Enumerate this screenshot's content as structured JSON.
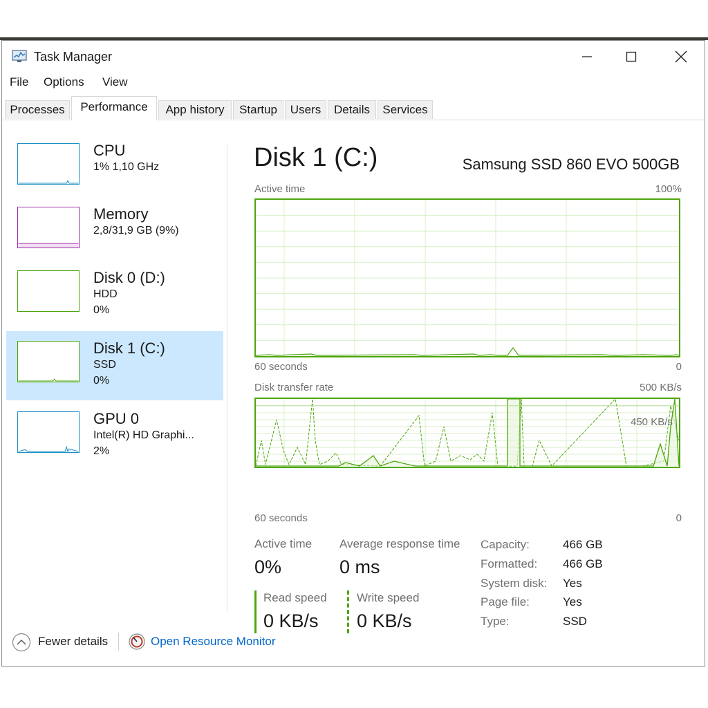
{
  "window": {
    "title": "Task Manager"
  },
  "menu": [
    "File",
    "Options",
    "View"
  ],
  "tabs": [
    "Processes",
    "Performance",
    "App history",
    "Startup",
    "Users",
    "Details",
    "Services"
  ],
  "sidebar": {
    "items": [
      {
        "title": "CPU",
        "sub1": "1% 1,10 GHz",
        "sub2": "",
        "color": "#1e8fc6"
      },
      {
        "title": "Memory",
        "sub1": "2,8/31,9 GB (9%)",
        "sub2": "",
        "color": "#9b2ca3"
      },
      {
        "title": "Disk 0 (D:)",
        "sub1": "HDD",
        "sub2": "0%",
        "color": "#4da60c"
      },
      {
        "title": "Disk 1 (C:)",
        "sub1": "SSD",
        "sub2": "0%",
        "color": "#4da60c"
      },
      {
        "title": "GPU 0",
        "sub1": "Intel(R) HD Graphi...",
        "sub2": "2%",
        "color": "#1e8fc6"
      }
    ]
  },
  "main": {
    "title": "Disk 1 (C:)",
    "model": "Samsung SSD 860 EVO 500GB",
    "graph1": {
      "label": "Active time",
      "max": "100%",
      "xleft": "60 seconds",
      "xright": "0"
    },
    "graph2": {
      "label": "Disk transfer rate",
      "max": "500 KB/s",
      "line_label": "450 KB/s",
      "xleft": "60 seconds",
      "xright": "0"
    },
    "stats": {
      "active_time_label": "Active time",
      "active_time_value": "0%",
      "avg_resp_label": "Average response time",
      "avg_resp_value": "0 ms",
      "read_label": "Read speed",
      "read_value": "0 KB/s",
      "write_label": "Write speed",
      "write_value": "0 KB/s"
    },
    "info": [
      {
        "label": "Capacity:",
        "value": "466 GB"
      },
      {
        "label": "Formatted:",
        "value": "466 GB"
      },
      {
        "label": "System disk:",
        "value": "Yes"
      },
      {
        "label": "Page file:",
        "value": "Yes"
      },
      {
        "label": "Type:",
        "value": "SSD"
      }
    ]
  },
  "footer": {
    "fewer": "Fewer details",
    "resmon": "Open Resource Monitor"
  },
  "colors": {
    "accent": "#4da60c",
    "link": "#0066cc",
    "selected": "#cce8ff"
  }
}
